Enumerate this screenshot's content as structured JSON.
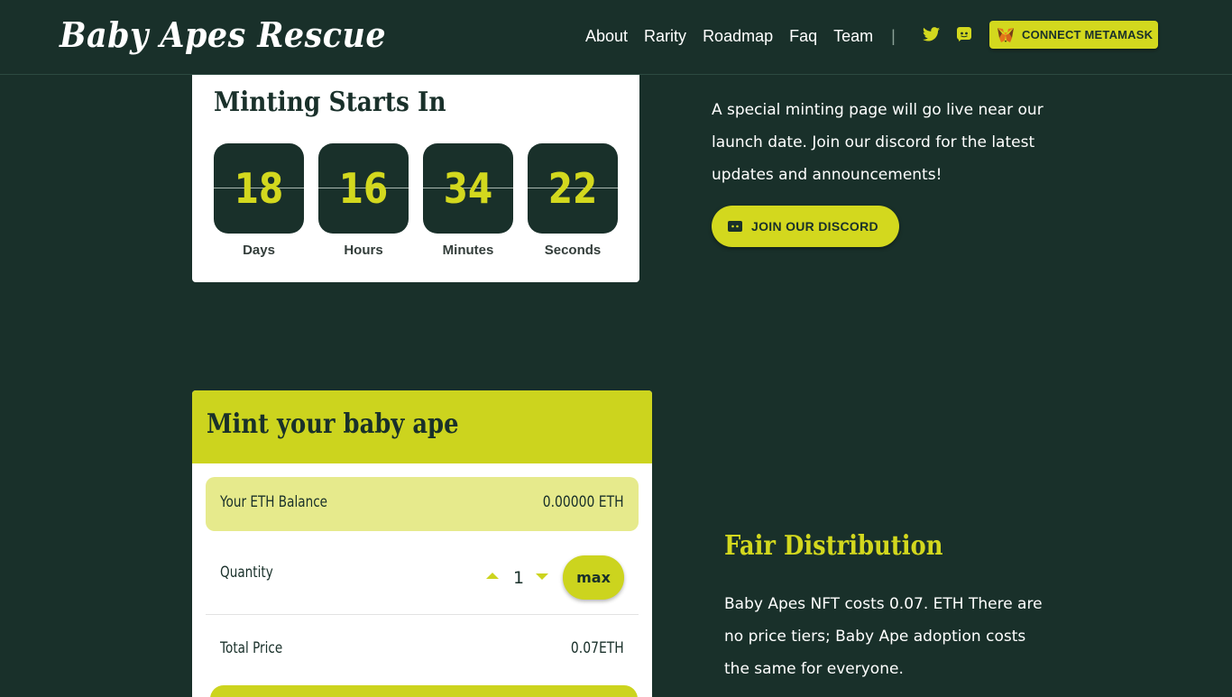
{
  "header": {
    "logo": "Baby Apes Rescue",
    "nav": [
      "About",
      "Rarity",
      "Roadmap",
      "Faq",
      "Team"
    ],
    "separator": "|",
    "social_icons": [
      "twitter-icon",
      "discord-icon"
    ],
    "connect_label": "CONNECT METAMASK",
    "connect_icon": "metamask-fox-icon"
  },
  "countdown": {
    "title": "Minting Starts In",
    "units": [
      {
        "value": "18",
        "label": "Days"
      },
      {
        "value": "16",
        "label": "Hours"
      },
      {
        "value": "34",
        "label": "Minutes"
      },
      {
        "value": "22",
        "label": "Seconds"
      }
    ]
  },
  "info": {
    "text": "A special minting page will go live near our launch date. Join our discord for the latest updates and announcements!",
    "discord_button": "JOIN OUR DISCORD"
  },
  "mint": {
    "title": "Mint your baby ape",
    "balance_label": "Your ETH Balance",
    "balance_value": "0.00000 ETH",
    "quantity_label": "Quantity",
    "quantity_value": "1",
    "max_label": "max",
    "total_label": "Total Price",
    "total_value": "0.07ETH"
  },
  "fair": {
    "title": "Fair Distribution",
    "text": "Baby Apes NFT costs 0.07. ETH There are no price tiers; Baby Ape adoption costs the same for everyone."
  },
  "colors": {
    "background": "#19302a",
    "accent": "#d3d81e",
    "balance_bg": "#e6ea8c"
  }
}
